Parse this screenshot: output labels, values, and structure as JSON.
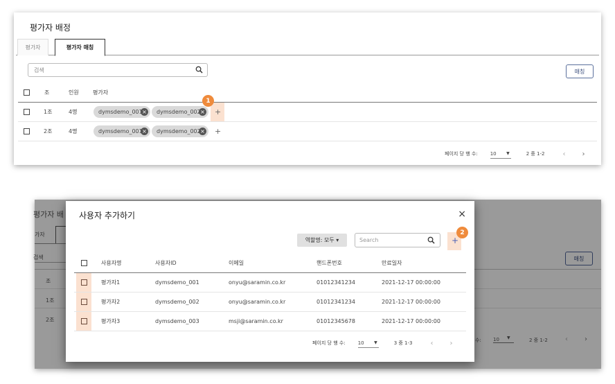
{
  "top": {
    "title": "평가자 배정",
    "tabs": [
      "평가자",
      "평가자 매칭"
    ],
    "search_placeholder": "검색",
    "match_button": "매칭",
    "columns": [
      "조",
      "인원",
      "평가자"
    ],
    "rows": [
      {
        "group": "1조",
        "count": "4명",
        "evaluators": [
          "dymsdemo_001",
          "dymsdemo_002"
        ]
      },
      {
        "group": "2조",
        "count": "4명",
        "evaluators": [
          "dymsdemo_001",
          "dymsdemo_002"
        ]
      }
    ],
    "add_symbol": "+",
    "chip_remove_symbol": "×",
    "badge": "1",
    "pager": {
      "label": "페이지 당 행 수:",
      "rows_per_page": "10",
      "range": "2 중 1-2",
      "prev": "‹",
      "next": "›"
    }
  },
  "background": {
    "title_fragment": "평가자 배",
    "tab_fragment": "가자",
    "search_fragment": "검색",
    "col_fragment": "조",
    "row1": "1조",
    "row2": "2조",
    "match_button": "매칭",
    "pager_fragment": "수:",
    "rows_per_page": "10",
    "range": "2 중 1-2"
  },
  "modal": {
    "title": "사용자 추가하기",
    "close_symbol": "×",
    "role_filter": "역할명: 모두 ▾",
    "search_placeholder": "Search",
    "add_symbol": "+",
    "badge": "2",
    "columns": [
      "사용자명",
      "사용자ID",
      "이메일",
      "핸드폰번호",
      "만료일자"
    ],
    "rows": [
      {
        "name": "평가자1",
        "id": "dymsdemo_001",
        "email": "onyu@saramin.co.kr",
        "phone": "01012341234",
        "expires": "2021-12-17 00:00:00"
      },
      {
        "name": "평가자2",
        "id": "dymsdemo_002",
        "email": "onyu@saramin.co.kr",
        "phone": "01012341234",
        "expires": "2021-12-17 00:00:00"
      },
      {
        "name": "평가자3",
        "id": "dymsdemo_003",
        "email": "msji@saramin.co.kr",
        "phone": "01012345678",
        "expires": "2021-12-17 00:00:00"
      }
    ],
    "pager": {
      "label": "페이지 당 행 수:",
      "rows_per_page": "10",
      "range": "3 중 1-3",
      "prev": "‹",
      "next": "›"
    }
  },
  "colors": {
    "accent": "#ef8b3c",
    "highlight": "#fbe1d0",
    "match_border": "#5a6f9c"
  }
}
